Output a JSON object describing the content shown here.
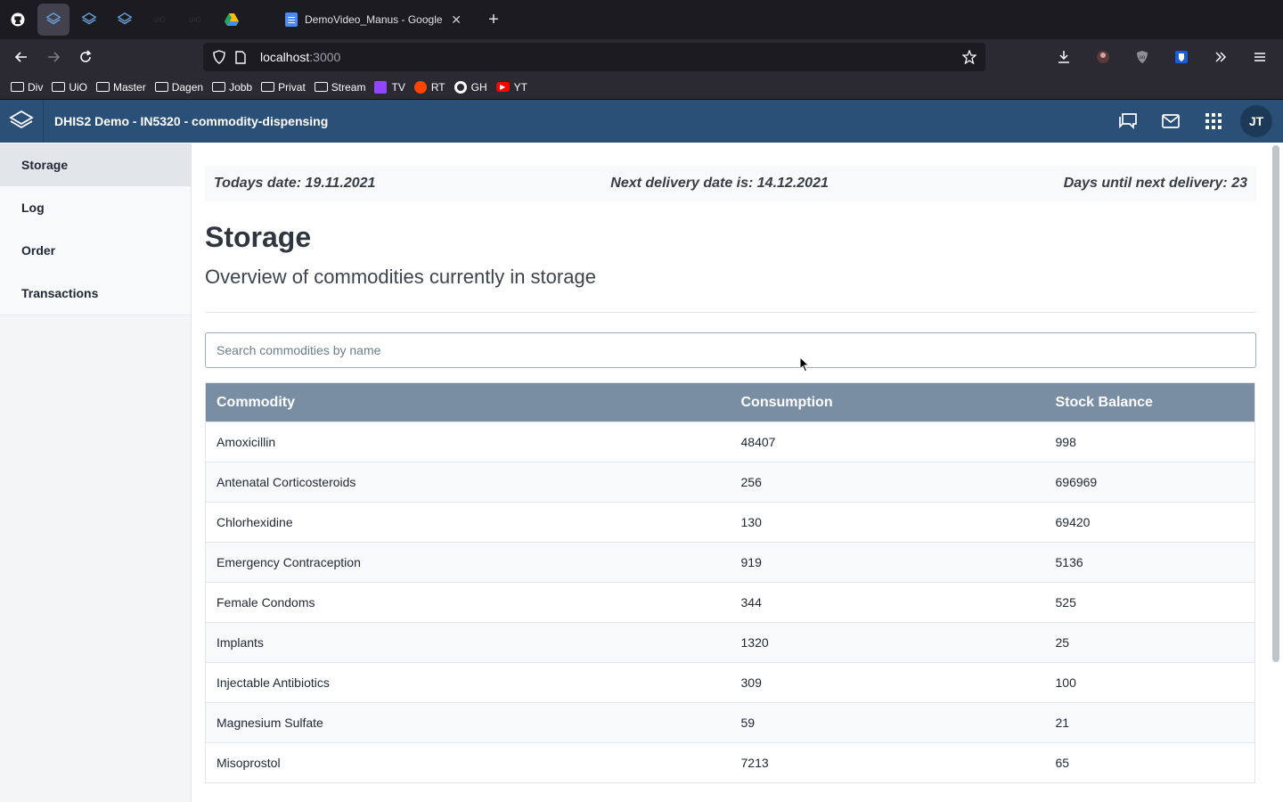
{
  "browser": {
    "tabs": [
      {
        "icon": "github-icon"
      },
      {
        "icon": "dhis2-icon",
        "active": true
      },
      {
        "icon": "dhis2-icon"
      },
      {
        "icon": "dhis2-icon"
      },
      {
        "icon": "uio-icon"
      },
      {
        "icon": "uio-icon"
      },
      {
        "icon": "google-drive-icon"
      }
    ],
    "main_tab_title": "DemoVideo_Manus - Google Dc",
    "new_tab_label": "+",
    "url_host": "localhost",
    "url_port": ":3000",
    "bookmarks": [
      {
        "label": "Div",
        "icon": "folder-icon"
      },
      {
        "label": "UiO",
        "icon": "folder-icon"
      },
      {
        "label": "Master",
        "icon": "folder-icon"
      },
      {
        "label": "Dagen",
        "icon": "folder-icon"
      },
      {
        "label": "Jobb",
        "icon": "folder-icon"
      },
      {
        "label": "Privat",
        "icon": "folder-icon"
      },
      {
        "label": "Stream",
        "icon": "folder-icon"
      },
      {
        "label": "TV",
        "icon": "twitch-icon"
      },
      {
        "label": "RT",
        "icon": "reddit-icon"
      },
      {
        "label": "GH",
        "icon": "github-icon"
      },
      {
        "label": "YT",
        "icon": "youtube-icon"
      }
    ]
  },
  "header": {
    "title": "DHIS2 Demo - IN5320 - commodity-dispensing",
    "avatar_initials": "JT",
    "color": "#2b5078"
  },
  "sidebar": {
    "items": [
      {
        "label": "Storage",
        "active": true
      },
      {
        "label": "Log"
      },
      {
        "label": "Order"
      },
      {
        "label": "Transactions"
      }
    ]
  },
  "info": {
    "today": "Todays date: 19.11.2021",
    "next_delivery": "Next delivery date is: 14.12.2021",
    "days_until": "Days until next delivery: 23"
  },
  "page": {
    "title": "Storage",
    "subtitle": "Overview of commodities currently in storage",
    "search_placeholder": "Search commodities by name"
  },
  "table": {
    "headers": [
      "Commodity",
      "Consumption",
      "Stock Balance"
    ],
    "rows": [
      [
        "Amoxicillin",
        "48407",
        "998"
      ],
      [
        "Antenatal Corticosteroids",
        "256",
        "696969"
      ],
      [
        "Chlorhexidine",
        "130",
        "69420"
      ],
      [
        "Emergency Contraception",
        "919",
        "5136"
      ],
      [
        "Female Condoms",
        "344",
        "525"
      ],
      [
        "Implants",
        "1320",
        "25"
      ],
      [
        "Injectable Antibiotics",
        "309",
        "100"
      ],
      [
        "Magnesium Sulfate",
        "59",
        "21"
      ],
      [
        "Misoprostol",
        "7213",
        "65"
      ]
    ]
  }
}
